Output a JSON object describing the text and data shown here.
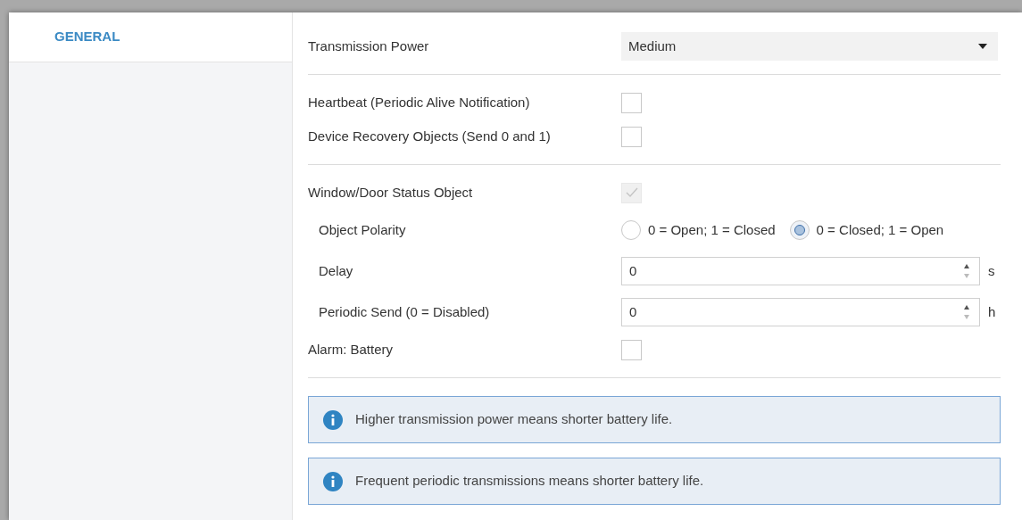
{
  "sidebar": {
    "items": [
      {
        "label": "GENERAL",
        "selected": true
      }
    ]
  },
  "sections": [
    {
      "rows": [
        {
          "kind": "select",
          "label": "Transmission Power",
          "value": "Medium",
          "indented": false
        }
      ]
    },
    {
      "rows": [
        {
          "kind": "checkbox",
          "label": "Heartbeat (Periodic Alive Notification)",
          "checked": false,
          "disabled": false,
          "indented": false
        },
        {
          "kind": "checkbox",
          "label": "Device Recovery Objects (Send 0 and 1)",
          "checked": false,
          "disabled": false,
          "indented": false
        }
      ]
    },
    {
      "rows": [
        {
          "kind": "checkbox",
          "label": "Window/Door Status Object",
          "checked": true,
          "disabled": true,
          "indented": false
        },
        {
          "kind": "radio",
          "label": "Object Polarity",
          "indented": true,
          "options": [
            {
              "label": "0 = Open; 1 = Closed",
              "selected": false
            },
            {
              "label": "0 = Closed; 1 = Open",
              "selected": true
            }
          ]
        },
        {
          "kind": "number",
          "label": "Delay",
          "value": "0",
          "unit": "s",
          "indented": true
        },
        {
          "kind": "number",
          "label": "Periodic Send (0 = Disabled)",
          "value": "0",
          "unit": "h",
          "indented": true
        },
        {
          "kind": "checkbox",
          "label": "Alarm: Battery",
          "checked": false,
          "disabled": false,
          "indented": false
        }
      ]
    }
  ],
  "notes": [
    {
      "text": "Higher transmission power means shorter battery life."
    },
    {
      "text": "Frequent periodic transmissions means shorter battery life."
    }
  ]
}
